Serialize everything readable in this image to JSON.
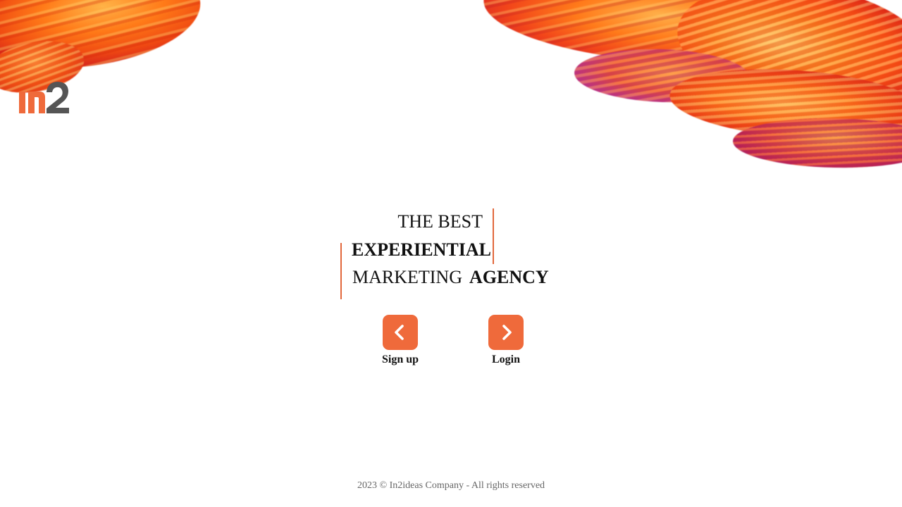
{
  "brand": {
    "logo_icon": "in2-logo-icon",
    "accent_color": "#ef6a3b",
    "logo_dark_color": "#555555"
  },
  "hero": {
    "line1": "THE BEST",
    "line2": "EXPERIENTIAL",
    "line3_regular": "MARKETING",
    "line3_bold": "AGENCY"
  },
  "nav": {
    "signup_label": "Sign up",
    "signup_icon": "chevron-left-icon",
    "login_label": "Login",
    "login_icon": "chevron-right-icon"
  },
  "footer": {
    "text": "2023 © In2ideas Company - All rights reserved"
  }
}
